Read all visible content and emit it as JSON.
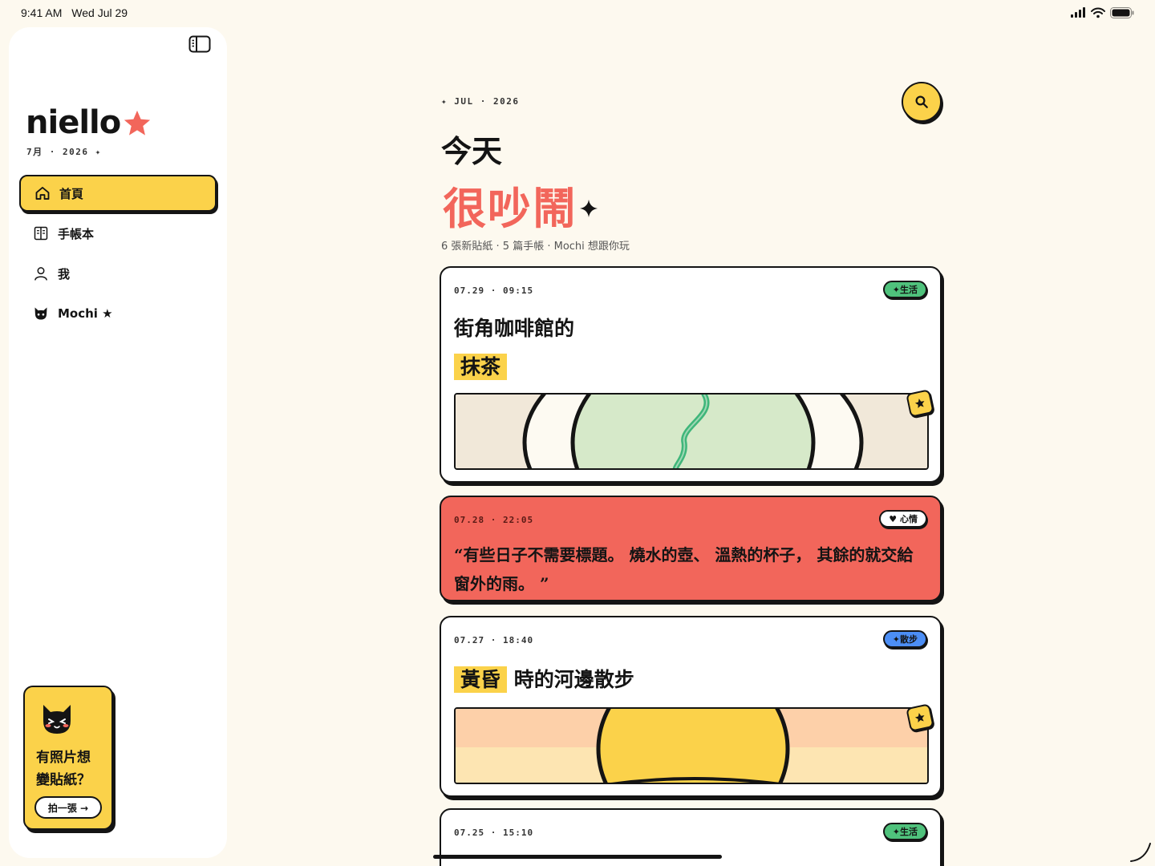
{
  "status_bar": {
    "time": "9:41 AM",
    "date": "Wed Jul 29"
  },
  "colors": {
    "accent_yellow": "#fbd24a",
    "accent_red": "#f2665b",
    "tag_green": "#4fc27c",
    "tag_blue": "#4c8ef5",
    "ink": "#141414",
    "background": "#fdf9ef"
  },
  "sidebar": {
    "toggle_icon": "sidebar-toggle-icon",
    "brand": {
      "name": "niello",
      "icon": "star-icon",
      "subtitle": "7月 · 2026 ✦"
    },
    "nav": [
      {
        "label": "首頁",
        "icon": "home-icon",
        "active": true
      },
      {
        "label": "手帳本",
        "icon": "notebook-icon",
        "active": false
      },
      {
        "label": "我",
        "icon": "person-icon",
        "active": false
      },
      {
        "label": "Mochi ★",
        "icon": "cat-icon",
        "active": false
      }
    ],
    "promo": {
      "icon": "cat-icon",
      "line1": "有照片想",
      "line2": "變貼紙？",
      "button": "拍一張 →"
    }
  },
  "main": {
    "eyebrow": "✦ JUL · 2026",
    "search_icon": "search-icon",
    "title": "今天",
    "mood": "很吵鬧",
    "stats": "6 張新貼紙 · 5 篇手帳 · Mochi 想跟你玩",
    "entries": [
      {
        "time": "07.29 · 09:15",
        "tag": "✦生活",
        "title_pre": "街角咖啡館的",
        "title_highlight": "抹茶",
        "has_photo": true
      },
      {
        "time": "07.28 · 22:05",
        "tag": "♥ 心情",
        "quote": "“有些日子不需要標題。 燒水的壺、 溫熱的杯子， 其餘的就交給窗外的雨。 ”"
      },
      {
        "time": "07.27 · 18:40",
        "tag": "✦散步",
        "title_highlight": "黃昏",
        "title_post": "時的河邊散步",
        "has_photo": true
      },
      {
        "time": "07.25 · 15:10",
        "tag": "✦生活"
      }
    ]
  }
}
